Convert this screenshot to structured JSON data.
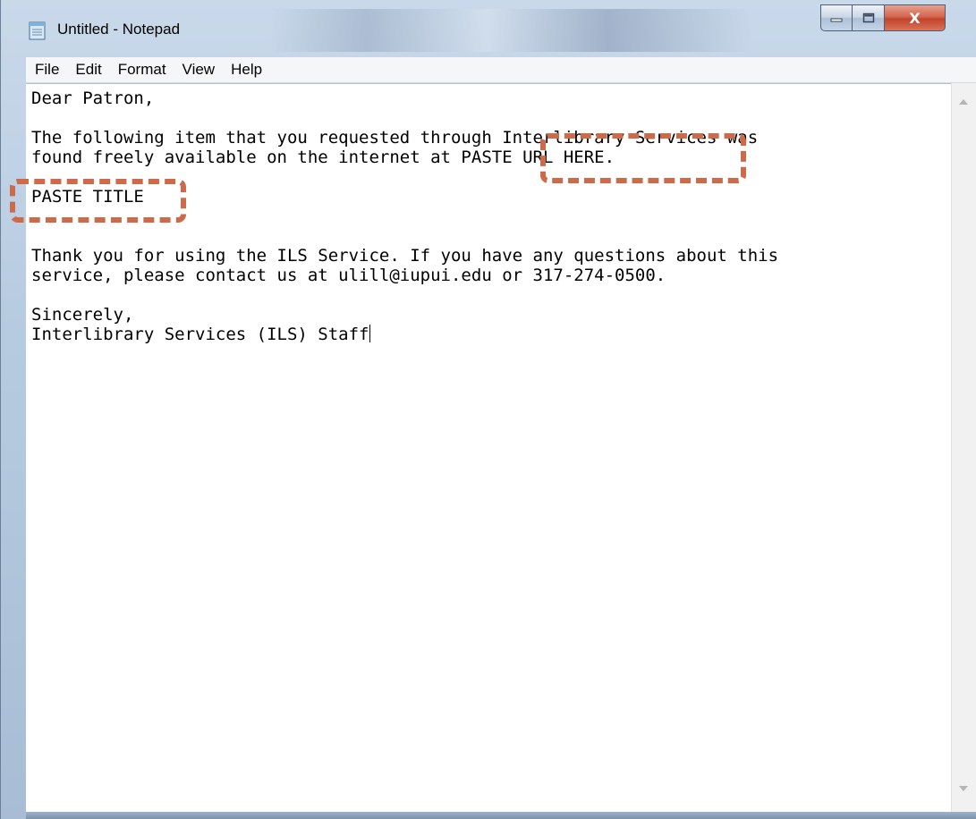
{
  "window": {
    "title": "Untitled - Notepad",
    "caption": {
      "minimize": "─",
      "maximize": "☐",
      "close": "X"
    }
  },
  "menu": [
    "File",
    "Edit",
    "Format",
    "View",
    "Help"
  ],
  "document": {
    "lines": [
      "Dear Patron,",
      "",
      "The following item that you requested through Interlibrary Services was",
      "found freely available on the internet at PASTE URL HERE.",
      "",
      "PASTE TITLE",
      "",
      "",
      "Thank you for using the ILS Service. If you have any questions about this",
      "service, please contact us at ulill@iupui.edu or 317-274-0500.",
      "",
      "Sincerely,",
      "Interlibrary Services (ILS) Staff"
    ]
  },
  "colors": {
    "annotation": "#cd6a4a"
  },
  "icons": {
    "app": "notepad-icon"
  }
}
